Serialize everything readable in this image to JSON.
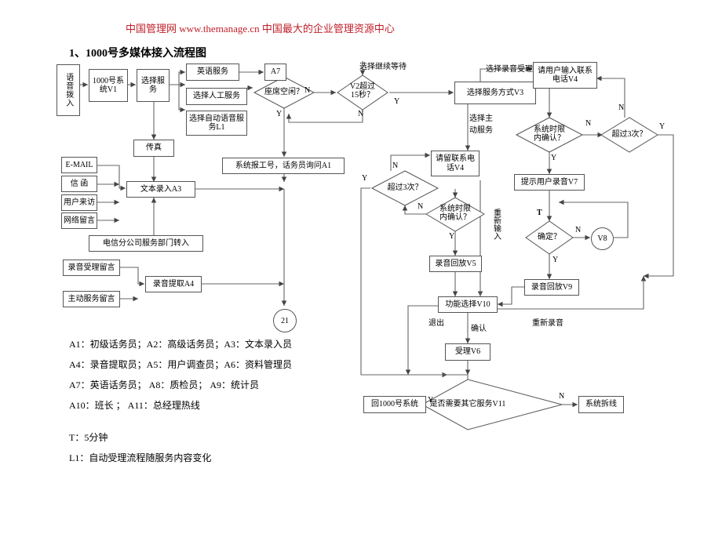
{
  "header": {
    "banner": "中国管理网 www.themanage.cn 中国最大的企业管理资源中心",
    "title": "1、1000号多媒体接入流程图"
  },
  "nodes": {
    "voice_in": "语音拨入",
    "sys_v1": "1000号系统V1",
    "choose_service": "选择服务",
    "english_service": "英语服务",
    "manual_service": "选择人工服务",
    "auto_service": "选择自动语音服务L1",
    "a7": "A7",
    "fax": "传真",
    "email": "E-MAIL",
    "letter": "信 函",
    "visit": "用户来访",
    "webmsg": "网络留言",
    "text_entry": "文本录入A3",
    "telecom_branch": "电信分公司服务部门转入",
    "rec_accept_msg": "录音受理留言",
    "active_service_msg": "主动服务留言",
    "rec_extract": "录音提取A4",
    "sys_report": "系统报工号，话务员询问A1",
    "service_mode_v3": "选择服务方式V3",
    "leave_phone_v4": "请留联系电话V4",
    "input_phone_v4": "请用户输入联系电话V4",
    "prompt_record_v7": "提示用户录音V7",
    "replay_v5": "录音回放V5",
    "replay_v9": "录音回放V9",
    "func_select_v10": "功能选择V10",
    "accept_v6": "受理V6",
    "back_1000": "回1000号系统",
    "sys_disconnect": "系统拆线",
    "junction_21": "21",
    "junction_v8": "V8"
  },
  "decisions": {
    "seat_free": "座席空闲？",
    "v2_over_15s": [
      "V2超过",
      "15秒？"
    ],
    "over_3_left": "超过3次？",
    "sys_confirm_left": [
      "系统时限",
      "内确认？"
    ],
    "sys_confirm_right": [
      "系统时限",
      "内确认？"
    ],
    "over_3_right": "超过3次？",
    "confirm_q": "确定？",
    "need_other_v11": "是否需要其它服务V11"
  },
  "edge_labels": {
    "continue_wait": "选择继续等待",
    "choose_recording": "选择录音受理",
    "choose_active": [
      "选择主",
      "动服务"
    ],
    "reinput": "重新输入",
    "t_five": "T",
    "exit": "退出",
    "confirm": "确认",
    "rerecord": "重新录音",
    "y": "Y",
    "n": "N"
  },
  "legend": {
    "line1": "A1：初级话务员；A2：高级话务员；A3：文本录入员",
    "line2": "A4：录音提取员；A5：用户调查员；A6：资料管理员",
    "line3": "A7：英语话务员； A8：质检员；     A9：统计员",
    "line4": "A10：班长 ；    A11：总经理热线",
    "line5": "T：5分钟",
    "line6": "L1：自动受理流程随服务内容变化"
  }
}
